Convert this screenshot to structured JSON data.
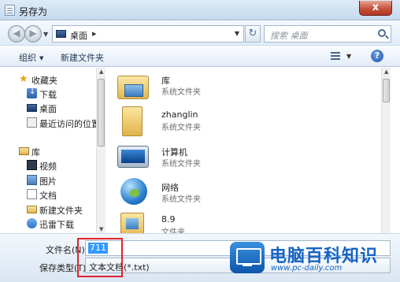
{
  "window": {
    "title": "另存为",
    "close_label": "x"
  },
  "address": {
    "back_label": "◀",
    "forward_label": "▶",
    "path": "桌面",
    "separator": "▸",
    "search_placeholder": "搜索 桌面"
  },
  "toolbar": {
    "organize": "组织",
    "new_folder": "新建文件夹"
  },
  "nav": {
    "favorites": "收藏夹",
    "downloads": "下载",
    "desktop": "桌面",
    "recent": "最近访问的位置",
    "library": "库",
    "videos": "视频",
    "pictures": "图片",
    "documents": "文档",
    "new_folder": "新建文件夹",
    "thunder": "迅雷下载"
  },
  "files": [
    {
      "name": "库",
      "type": "系统文件夹",
      "icon": "library-icon"
    },
    {
      "name": "zhanglin",
      "type": "系统文件夹",
      "icon": "user-folder-icon"
    },
    {
      "name": "计算机",
      "type": "系统文件夹",
      "icon": "computer-icon"
    },
    {
      "name": "网络",
      "type": "系统文件夹",
      "icon": "network-icon"
    },
    {
      "name": "8.9",
      "type": "文件夹",
      "icon": "folder-icon"
    }
  ],
  "bottom": {
    "filename_label": "文件名(N):",
    "filename_value": "711",
    "filetype_label": "保存类型(T):",
    "filetype_value": "文本文档(*.txt)"
  },
  "watermark": {
    "title": "电脑百科知识",
    "url": "www.pc-daily.com"
  },
  "colors": {
    "highlight": "#e0242d",
    "selection": "#3399ff",
    "brand": "#1464c4"
  }
}
